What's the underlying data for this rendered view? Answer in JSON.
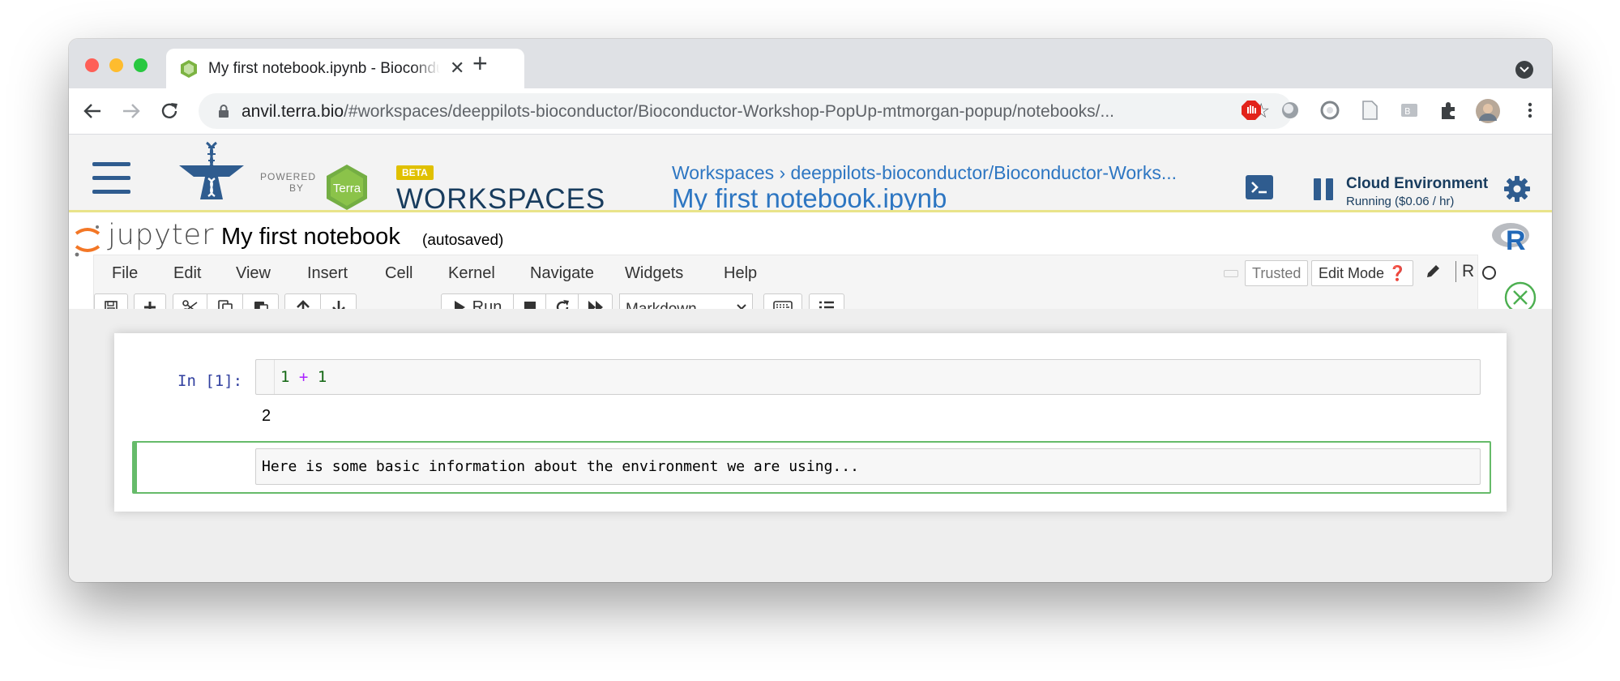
{
  "browser": {
    "tab_title": "My first notebook.ipynb - Bioconductor",
    "tab_close": "✕",
    "new_tab": "+",
    "url_host": "anvil.terra.bio",
    "url_path": "/#workspaces/deeppilots-bioconductor/Bioconductor-Workshop-PopUp-mtmorgan-popup/notebooks/...",
    "star": "☆",
    "extension_icons": [
      "adblock-icon",
      "circle-icon",
      "refresh-ext-icon",
      "page-icon",
      "bookmark-ext-icon",
      "puzzle-icon",
      "profile-avatar",
      "more-vert-icon"
    ]
  },
  "terra": {
    "powered_by": "POWERED BY",
    "terra_label": "Terra",
    "beta": "BETA",
    "app_title": "WORKSPACES",
    "breadcrumb": "Workspaces › deeppilots-bioconductor/Bioconductor-Works...",
    "notebook_title": "My first notebook.ipynb",
    "cloud_env_title": "Cloud Environment",
    "cloud_env_status": "Running ($0.06 / hr)",
    "accent": "#2f5c8f"
  },
  "jupyter": {
    "logo_text": "jupyter",
    "notebook_name": "My first notebook",
    "save_status": "(autosaved)",
    "kernel_logo": "R",
    "menu": [
      "File",
      "Edit",
      "View",
      "Insert",
      "Cell",
      "Kernel",
      "Navigate",
      "Widgets",
      "Help"
    ],
    "trusted": "Trusted",
    "edit_mode": "Edit Mode",
    "kernel_name": "R",
    "run_label": "Run",
    "cell_type": "Markdown"
  },
  "cells": {
    "prompt": "In [1]:",
    "code_a": "1",
    "code_op": "+",
    "code_b": "1",
    "output": "2",
    "markdown_text": "Here is some basic information about the environment we are using..."
  }
}
